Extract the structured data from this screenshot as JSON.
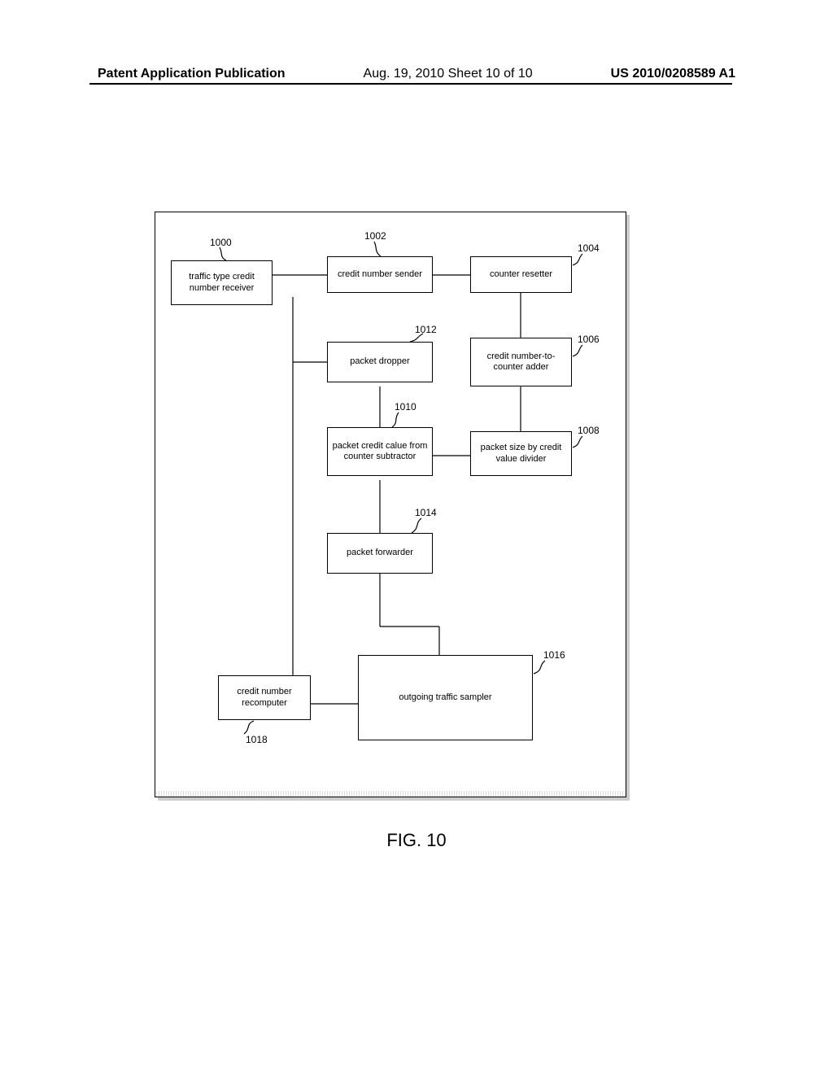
{
  "header": {
    "left": "Patent Application Publication",
    "center": "Aug. 19, 2010  Sheet 10 of 10",
    "right": "US 2010/0208589 A1"
  },
  "figure_label": "FIG. 10",
  "boxes": {
    "b1000": {
      "label": "traffic type credit number receiver",
      "ref": "1000"
    },
    "b1002": {
      "label": "credit number sender",
      "ref": "1002"
    },
    "b1004": {
      "label": "counter resetter",
      "ref": "1004"
    },
    "b1006": {
      "label": "credit number-to-counter adder",
      "ref": "1006"
    },
    "b1008": {
      "label": "packet size by credit value divider",
      "ref": "1008"
    },
    "b1010": {
      "label": "packet credit calue from counter subtractor",
      "ref": "1010"
    },
    "b1012": {
      "label": "packet dropper",
      "ref": "1012"
    },
    "b1014": {
      "label": "packet forwarder",
      "ref": "1014"
    },
    "b1016": {
      "label": "outgoing traffic sampler",
      "ref": "1016"
    },
    "b1018": {
      "label": "credit number recomputer",
      "ref": "1018"
    }
  }
}
